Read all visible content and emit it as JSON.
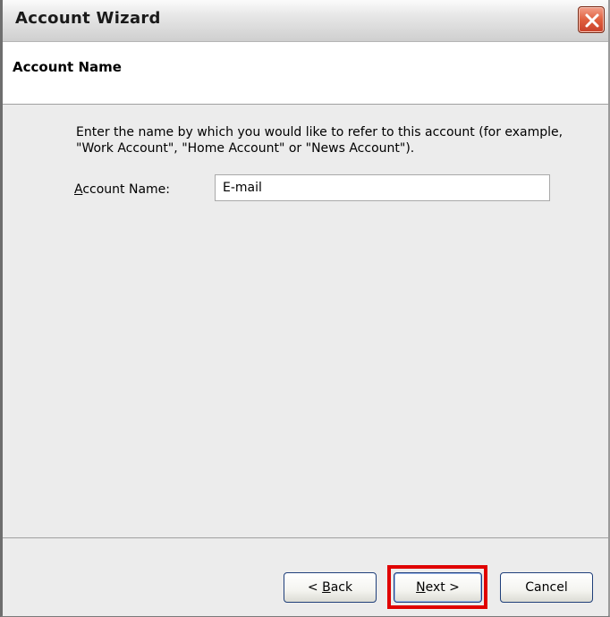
{
  "window": {
    "title": "Account Wizard",
    "close_icon": "close-icon"
  },
  "header": {
    "title": "Account Name"
  },
  "content": {
    "description": "Enter the name by which you would like to refer to this account (for example, \"Work Account\", \"Home Account\" or \"News Account\").",
    "account_name_label_prefix": "A",
    "account_name_label_rest": "ccount Name:",
    "account_name_value": "E-mail"
  },
  "footer": {
    "back_prefix": "< ",
    "back_accel": "B",
    "back_rest": "ack",
    "next_accel": "N",
    "next_rest": "ext >",
    "cancel_label": "Cancel",
    "highlight_color": "#e00000"
  }
}
